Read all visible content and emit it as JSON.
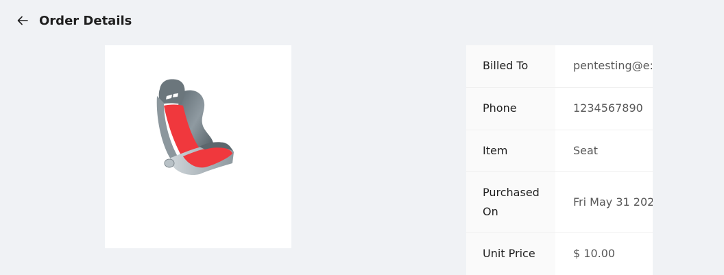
{
  "header": {
    "back_icon": "arrow-left-icon",
    "title": "Order Details"
  },
  "product": {
    "image_icon": "car-seat-image"
  },
  "details": {
    "rows": [
      {
        "label": "Billed To",
        "value": "pentesting@e:"
      },
      {
        "label": "Phone",
        "value": "1234567890"
      },
      {
        "label": "Item",
        "value": "Seat"
      },
      {
        "label": "Purchased On",
        "value": "Fri May 31 202"
      },
      {
        "label": "Unit Price",
        "value": "$ 10.00"
      }
    ]
  },
  "colors": {
    "background": "#f0f2f5",
    "card": "#ffffff",
    "label_bg": "#fafafa",
    "seat_red": "#f0383d"
  }
}
